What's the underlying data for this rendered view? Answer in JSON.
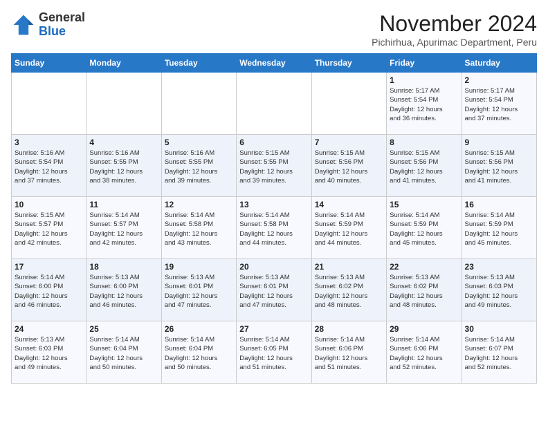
{
  "logo": {
    "text_general": "General",
    "text_blue": "Blue"
  },
  "title": "November 2024",
  "subtitle": "Pichirhua, Apurimac Department, Peru",
  "days_of_week": [
    "Sunday",
    "Monday",
    "Tuesday",
    "Wednesday",
    "Thursday",
    "Friday",
    "Saturday"
  ],
  "weeks": [
    [
      {
        "day": "",
        "info": ""
      },
      {
        "day": "",
        "info": ""
      },
      {
        "day": "",
        "info": ""
      },
      {
        "day": "",
        "info": ""
      },
      {
        "day": "",
        "info": ""
      },
      {
        "day": "1",
        "info": "Sunrise: 5:17 AM\nSunset: 5:54 PM\nDaylight: 12 hours\nand 36 minutes."
      },
      {
        "day": "2",
        "info": "Sunrise: 5:17 AM\nSunset: 5:54 PM\nDaylight: 12 hours\nand 37 minutes."
      }
    ],
    [
      {
        "day": "3",
        "info": "Sunrise: 5:16 AM\nSunset: 5:54 PM\nDaylight: 12 hours\nand 37 minutes."
      },
      {
        "day": "4",
        "info": "Sunrise: 5:16 AM\nSunset: 5:55 PM\nDaylight: 12 hours\nand 38 minutes."
      },
      {
        "day": "5",
        "info": "Sunrise: 5:16 AM\nSunset: 5:55 PM\nDaylight: 12 hours\nand 39 minutes."
      },
      {
        "day": "6",
        "info": "Sunrise: 5:15 AM\nSunset: 5:55 PM\nDaylight: 12 hours\nand 39 minutes."
      },
      {
        "day": "7",
        "info": "Sunrise: 5:15 AM\nSunset: 5:56 PM\nDaylight: 12 hours\nand 40 minutes."
      },
      {
        "day": "8",
        "info": "Sunrise: 5:15 AM\nSunset: 5:56 PM\nDaylight: 12 hours\nand 41 minutes."
      },
      {
        "day": "9",
        "info": "Sunrise: 5:15 AM\nSunset: 5:56 PM\nDaylight: 12 hours\nand 41 minutes."
      }
    ],
    [
      {
        "day": "10",
        "info": "Sunrise: 5:15 AM\nSunset: 5:57 PM\nDaylight: 12 hours\nand 42 minutes."
      },
      {
        "day": "11",
        "info": "Sunrise: 5:14 AM\nSunset: 5:57 PM\nDaylight: 12 hours\nand 42 minutes."
      },
      {
        "day": "12",
        "info": "Sunrise: 5:14 AM\nSunset: 5:58 PM\nDaylight: 12 hours\nand 43 minutes."
      },
      {
        "day": "13",
        "info": "Sunrise: 5:14 AM\nSunset: 5:58 PM\nDaylight: 12 hours\nand 44 minutes."
      },
      {
        "day": "14",
        "info": "Sunrise: 5:14 AM\nSunset: 5:59 PM\nDaylight: 12 hours\nand 44 minutes."
      },
      {
        "day": "15",
        "info": "Sunrise: 5:14 AM\nSunset: 5:59 PM\nDaylight: 12 hours\nand 45 minutes."
      },
      {
        "day": "16",
        "info": "Sunrise: 5:14 AM\nSunset: 5:59 PM\nDaylight: 12 hours\nand 45 minutes."
      }
    ],
    [
      {
        "day": "17",
        "info": "Sunrise: 5:14 AM\nSunset: 6:00 PM\nDaylight: 12 hours\nand 46 minutes."
      },
      {
        "day": "18",
        "info": "Sunrise: 5:13 AM\nSunset: 6:00 PM\nDaylight: 12 hours\nand 46 minutes."
      },
      {
        "day": "19",
        "info": "Sunrise: 5:13 AM\nSunset: 6:01 PM\nDaylight: 12 hours\nand 47 minutes."
      },
      {
        "day": "20",
        "info": "Sunrise: 5:13 AM\nSunset: 6:01 PM\nDaylight: 12 hours\nand 47 minutes."
      },
      {
        "day": "21",
        "info": "Sunrise: 5:13 AM\nSunset: 6:02 PM\nDaylight: 12 hours\nand 48 minutes."
      },
      {
        "day": "22",
        "info": "Sunrise: 5:13 AM\nSunset: 6:02 PM\nDaylight: 12 hours\nand 48 minutes."
      },
      {
        "day": "23",
        "info": "Sunrise: 5:13 AM\nSunset: 6:03 PM\nDaylight: 12 hours\nand 49 minutes."
      }
    ],
    [
      {
        "day": "24",
        "info": "Sunrise: 5:13 AM\nSunset: 6:03 PM\nDaylight: 12 hours\nand 49 minutes."
      },
      {
        "day": "25",
        "info": "Sunrise: 5:14 AM\nSunset: 6:04 PM\nDaylight: 12 hours\nand 50 minutes."
      },
      {
        "day": "26",
        "info": "Sunrise: 5:14 AM\nSunset: 6:04 PM\nDaylight: 12 hours\nand 50 minutes."
      },
      {
        "day": "27",
        "info": "Sunrise: 5:14 AM\nSunset: 6:05 PM\nDaylight: 12 hours\nand 51 minutes."
      },
      {
        "day": "28",
        "info": "Sunrise: 5:14 AM\nSunset: 6:06 PM\nDaylight: 12 hours\nand 51 minutes."
      },
      {
        "day": "29",
        "info": "Sunrise: 5:14 AM\nSunset: 6:06 PM\nDaylight: 12 hours\nand 52 minutes."
      },
      {
        "day": "30",
        "info": "Sunrise: 5:14 AM\nSunset: 6:07 PM\nDaylight: 12 hours\nand 52 minutes."
      }
    ]
  ]
}
